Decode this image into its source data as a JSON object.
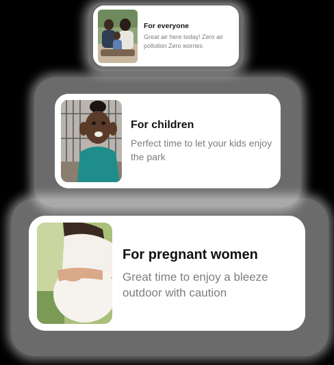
{
  "cards": [
    {
      "title": "For everyone",
      "description": "Great air here today! Zero air pollution Zero worries",
      "image": "family-photo"
    },
    {
      "title": "For children",
      "description": "Perfect time to let your kids enjoy the park",
      "image": "child-photo"
    },
    {
      "title": "For pregnant women",
      "description": "Great time to enjoy a bleeze outdoor with caution",
      "image": "pregnant-woman-photo"
    }
  ]
}
